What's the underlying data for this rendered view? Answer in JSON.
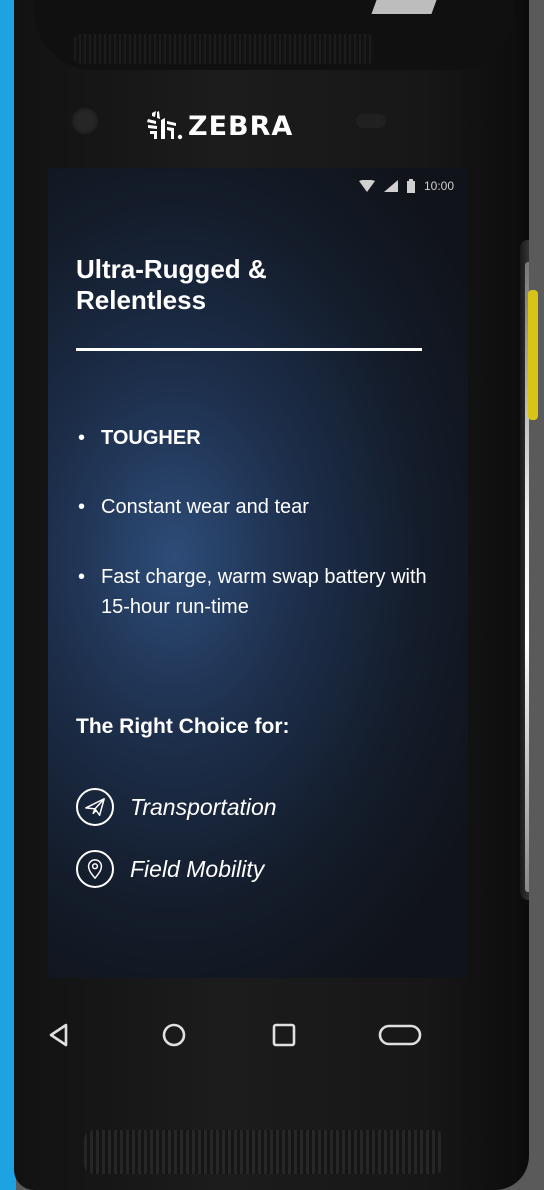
{
  "device": {
    "brand": "ZEBRA",
    "accent_color": "#1ea3e2",
    "button_color": "#d8c416"
  },
  "status_bar": {
    "icons": [
      "wifi-icon",
      "signal-icon",
      "battery-icon"
    ],
    "time": "10:00"
  },
  "content": {
    "headline": "Ultra-Rugged & Relentless",
    "bullets": [
      {
        "text": "TOUGHER",
        "bold": true
      },
      {
        "text": "Constant wear and tear",
        "bold": false
      },
      {
        "text": "Fast charge, warm swap battery with 15-hour run-time",
        "bold": false
      }
    ],
    "subheading": "The Right Choice for:",
    "choices": [
      {
        "label": "Transportation",
        "icon": "airplane-icon"
      },
      {
        "label": "Field Mobility",
        "icon": "map-pin-icon"
      }
    ]
  },
  "nav_bar": {
    "buttons": [
      "back-icon",
      "home-icon",
      "recents-icon",
      "pill-icon"
    ]
  }
}
